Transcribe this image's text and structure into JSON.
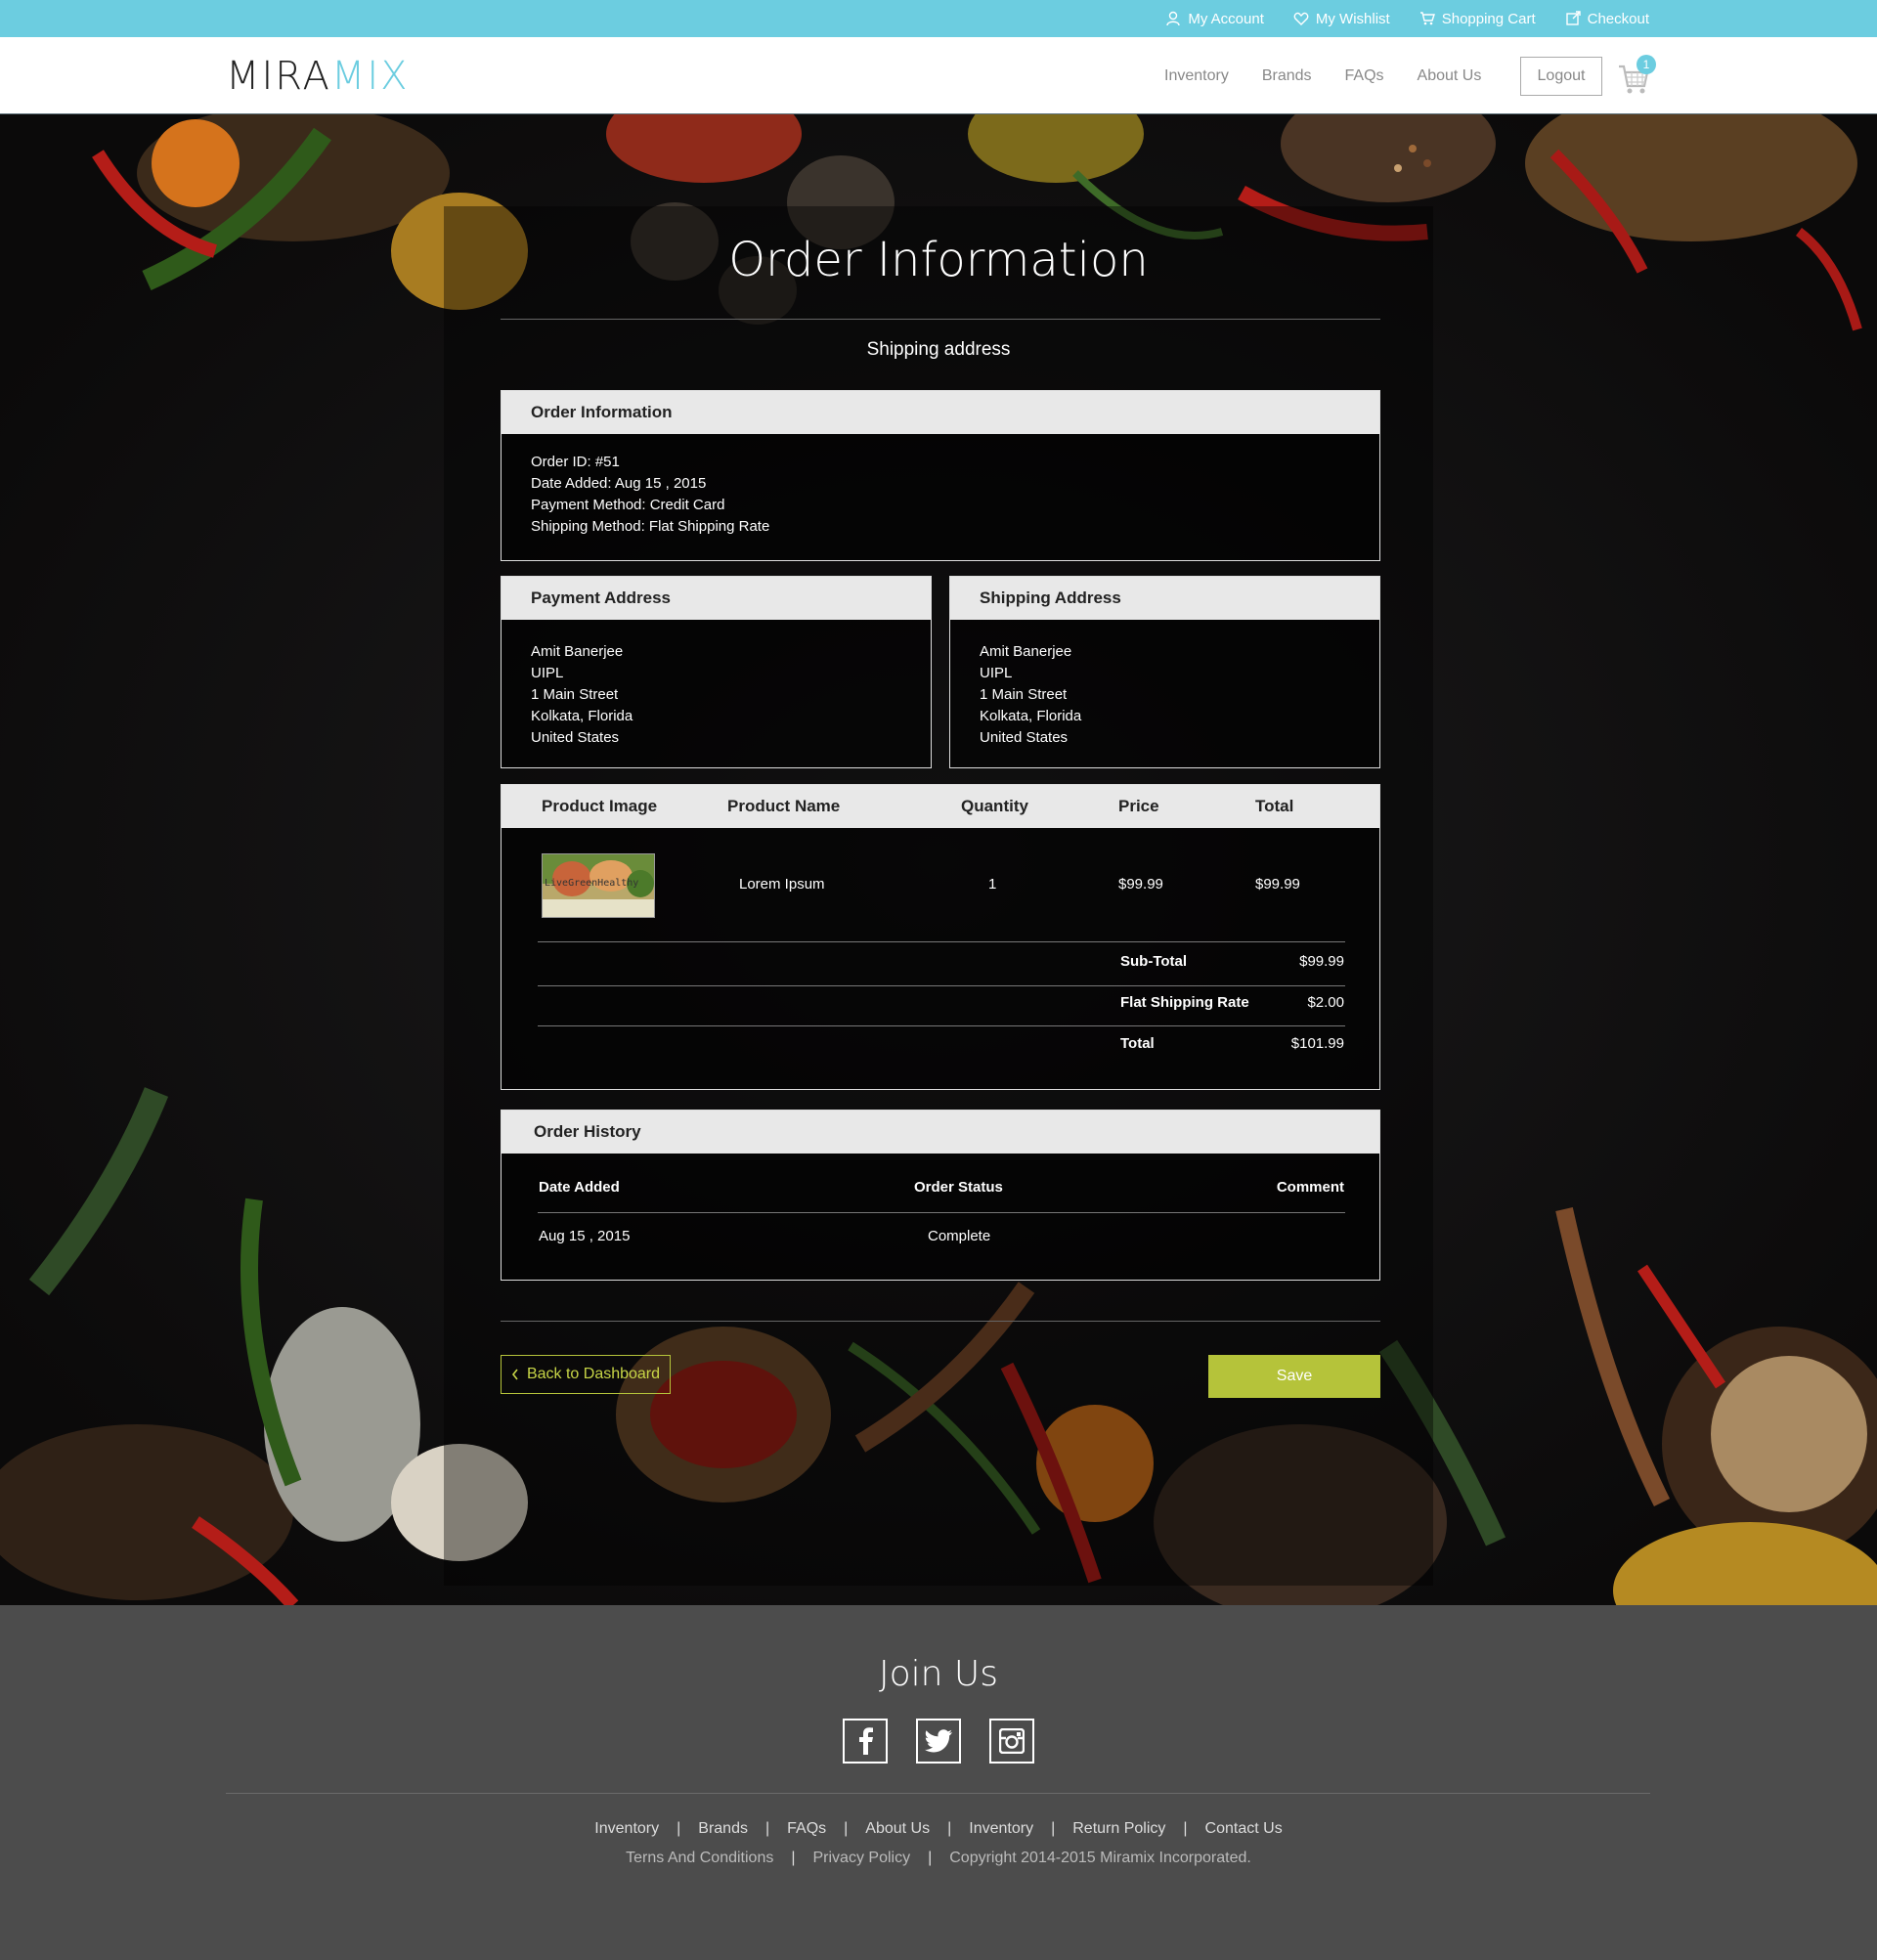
{
  "topbar": {
    "my_account": "My Account",
    "my_wishlist": "My Wishlist",
    "shopping_cart": "Shopping Cart",
    "checkout": "Checkout"
  },
  "brand": {
    "part1": "MIRA",
    "part2": "MIX"
  },
  "nav": {
    "inventory": "Inventory",
    "brands": "Brands",
    "faqs": "FAQs",
    "about": "About Us",
    "logout": "Logout",
    "cart_count": "1"
  },
  "page": {
    "title": "Order Information",
    "subtitle": "Shipping address"
  },
  "order_info": {
    "heading": "Order Information",
    "order_id": "Order ID: #51",
    "date_added": "Date Added: Aug 15 , 2015",
    "payment_method": "Payment Method: Credit Card",
    "shipping_method": "Shipping Method: Flat Shipping Rate"
  },
  "payment_address": {
    "heading": "Payment Address",
    "lines": [
      "Amit Banerjee",
      "UIPL",
      "1 Main Street",
      "Kolkata, Florida",
      "United States"
    ]
  },
  "shipping_address": {
    "heading": "Shipping Address",
    "lines": [
      "Amit Banerjee",
      "UIPL",
      "1 Main Street",
      "Kolkata, Florida",
      "United States"
    ]
  },
  "products": {
    "columns": [
      "Product Image",
      "Product Name",
      "Quantity",
      "Price",
      "Total"
    ],
    "rows": [
      {
        "name": "Lorem Ipsum",
        "quantity": "1",
        "price": "$99.99",
        "total": "$99.99",
        "image_text": "LiveGreenHealthy"
      }
    ],
    "totals": [
      {
        "label": "Sub-Total",
        "value": "$99.99"
      },
      {
        "label": "Flat Shipping Rate",
        "value": "$2.00"
      },
      {
        "label": "Total",
        "value": "$101.99"
      }
    ]
  },
  "history": {
    "heading": "Order History",
    "columns": [
      "Date Added",
      "Order Status",
      "Comment"
    ],
    "rows": [
      {
        "date": "Aug 15 , 2015",
        "status": "Complete",
        "comment": ""
      }
    ]
  },
  "actions": {
    "back": "Back to Dashboard",
    "save": "Save"
  },
  "footer": {
    "join": "Join Us",
    "links": [
      "Inventory",
      "Brands",
      "FAQs",
      "About Us",
      "Inventory",
      "Return Policy",
      "Contact Us"
    ],
    "terms": "Terns And Conditions",
    "privacy": "Privacy Policy",
    "copyright": "Copyright 2014-2015 Miramix Incorporated."
  },
  "colors": {
    "accent": "#6ccde0",
    "button_green": "#b5c33a",
    "footer_bg": "#4c4c4c"
  }
}
